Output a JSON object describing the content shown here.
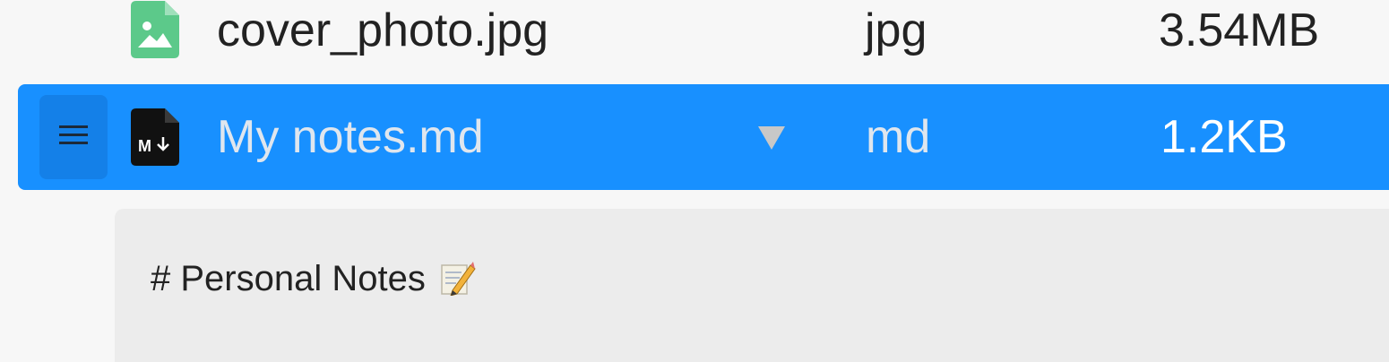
{
  "files": [
    {
      "name": "cover_photo.jpg",
      "type": "jpg",
      "size": "3.54MB",
      "icon": "image-file-icon",
      "selected": false
    },
    {
      "name": "My notes.md",
      "type": "md",
      "size": "1.2KB",
      "icon": "markdown-file-icon",
      "selected": true
    }
  ],
  "preview": {
    "heading": "# Personal Notes",
    "heading_icon": "pencil-memo-icon"
  },
  "colors": {
    "selection": "#1890ff",
    "image_icon": "#5cc98a",
    "markdown_icon": "#111111"
  }
}
